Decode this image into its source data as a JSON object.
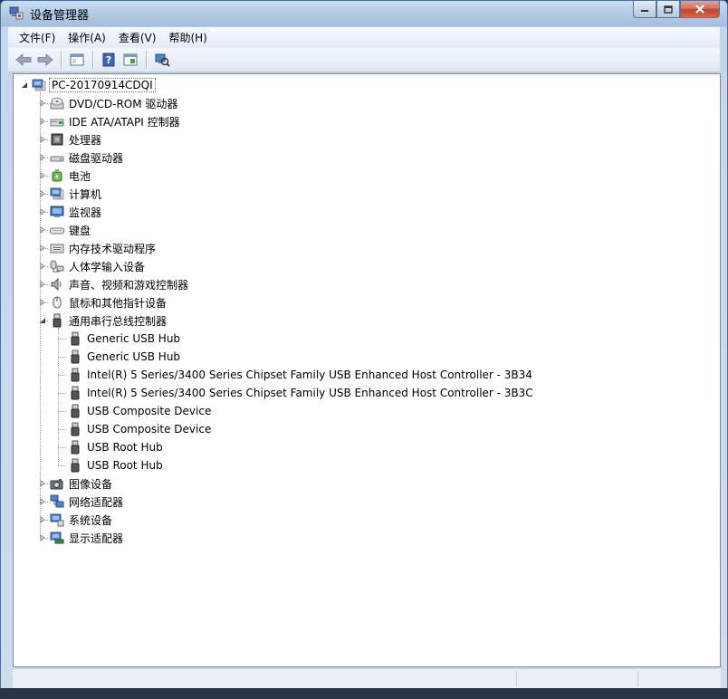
{
  "window": {
    "title": "设备管理器",
    "icon": "device-manager-icon",
    "accent": "#a6bfdf",
    "close_color": "#c2432a"
  },
  "menu": [
    {
      "label": "文件(F)",
      "name": "file"
    },
    {
      "label": "操作(A)",
      "name": "action"
    },
    {
      "label": "查看(V)",
      "name": "view"
    },
    {
      "label": "帮助(H)",
      "name": "help"
    }
  ],
  "toolbar": [
    "back-arrow-icon",
    "forward-arrow-icon",
    "show-hide-tree-icon",
    "help-icon",
    "properties-icon",
    "scan-hardware-icon"
  ],
  "tree": {
    "root": {
      "label": "PC-20170914CDQI",
      "icon": "computer-icon",
      "expanded": true
    },
    "categories": [
      {
        "label": "DVD/CD-ROM 驱动器",
        "icon": "dvd-drive-icon",
        "expanded": false
      },
      {
        "label": "IDE ATA/ATAPI 控制器",
        "icon": "ide-controller-icon",
        "expanded": false
      },
      {
        "label": "处理器",
        "icon": "processor-icon",
        "expanded": false
      },
      {
        "label": "磁盘驱动器",
        "icon": "disk-drive-icon",
        "expanded": false
      },
      {
        "label": "电池",
        "icon": "battery-icon",
        "expanded": false
      },
      {
        "label": "计算机",
        "icon": "computer-icon",
        "expanded": false
      },
      {
        "label": "监视器",
        "icon": "monitor-icon",
        "expanded": false
      },
      {
        "label": "键盘",
        "icon": "keyboard-icon",
        "expanded": false
      },
      {
        "label": "内存技术驱动程序",
        "icon": "memory-icon",
        "expanded": false
      },
      {
        "label": "人体学输入设备",
        "icon": "hid-icon",
        "expanded": false
      },
      {
        "label": "声音、视频和游戏控制器",
        "icon": "sound-icon",
        "expanded": false
      },
      {
        "label": "鼠标和其他指针设备",
        "icon": "mouse-icon",
        "expanded": false
      },
      {
        "label": "通用串行总线控制器",
        "icon": "usb-icon",
        "expanded": true,
        "children": [
          "Generic USB Hub",
          "Generic USB Hub",
          "Intel(R) 5 Series/3400 Series Chipset Family USB Enhanced Host Controller - 3B34",
          "Intel(R) 5 Series/3400 Series Chipset Family USB Enhanced Host Controller - 3B3C",
          "USB Composite Device",
          "USB Composite Device",
          "USB Root Hub",
          "USB Root Hub"
        ]
      },
      {
        "label": "图像设备",
        "icon": "imaging-icon",
        "expanded": false
      },
      {
        "label": "网络适配器",
        "icon": "network-adapter-icon",
        "expanded": false
      },
      {
        "label": "系统设备",
        "icon": "system-device-icon",
        "expanded": false
      },
      {
        "label": "显示适配器",
        "icon": "display-adapter-icon",
        "expanded": false
      }
    ]
  }
}
